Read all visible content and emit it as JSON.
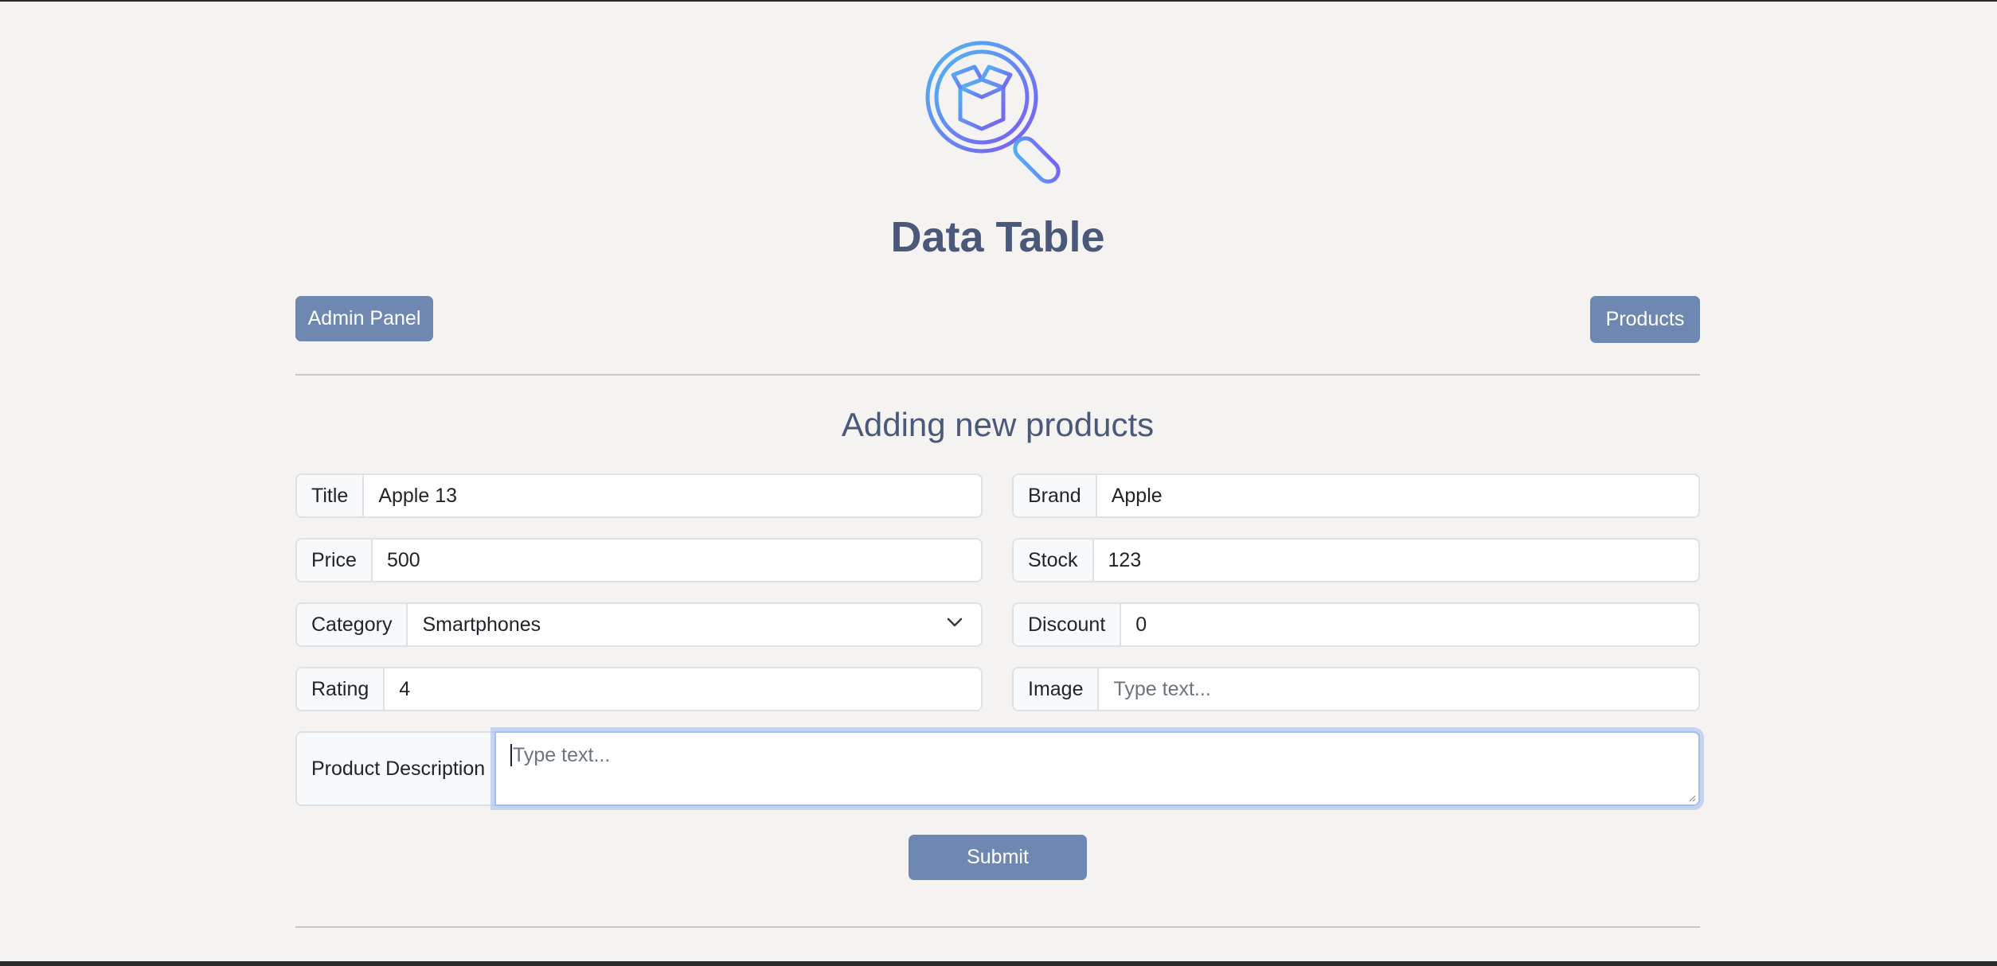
{
  "header": {
    "title": "Data Table",
    "logo_icon": "package-search-icon"
  },
  "nav": {
    "admin_label": "Admin Panel",
    "products_label": "Products"
  },
  "form": {
    "heading": "Adding new products",
    "title": {
      "label": "Title",
      "value": "Apple 13"
    },
    "brand": {
      "label": "Brand",
      "value": "Apple"
    },
    "price": {
      "label": "Price",
      "value": "500"
    },
    "stock": {
      "label": "Stock",
      "value": "123"
    },
    "category": {
      "label": "Category",
      "value": "Smartphones"
    },
    "discount": {
      "label": "Discount",
      "value": "0"
    },
    "rating": {
      "label": "Rating",
      "value": "4"
    },
    "image": {
      "label": "Image",
      "value": "",
      "placeholder": "Type text..."
    },
    "description": {
      "label": "Product Description",
      "value": "",
      "placeholder": "Type text..."
    },
    "submit_label": "Submit"
  },
  "colors": {
    "button": "#6f88b1",
    "title": "#4a5879",
    "background": "#f4f3f2",
    "logo_gradient_start": "#4fb6f2",
    "logo_gradient_end": "#7b5cf0"
  }
}
